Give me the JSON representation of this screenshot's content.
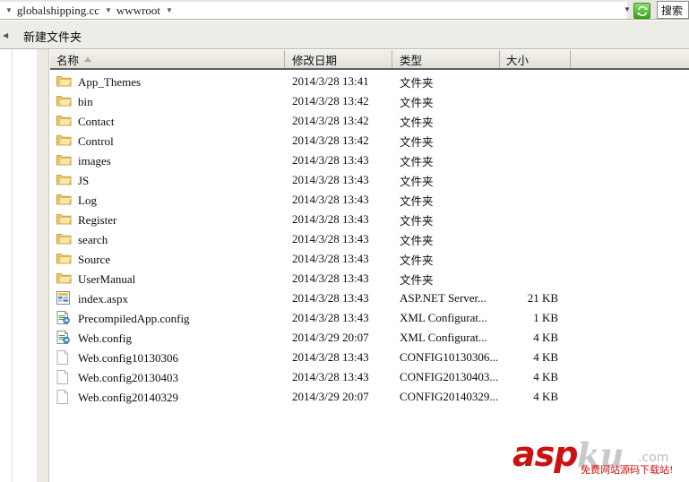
{
  "address_bar": {
    "breadcrumb": [
      "globalshipping.cc",
      "wwwroot"
    ],
    "dropdown_icon": "chevron-down-icon",
    "refresh_icon": "refresh-icon",
    "search_placeholder": "搜索"
  },
  "toolbar": {
    "overflow_icon": "chevron-left-icon",
    "new_folder_label": "新建文件夹"
  },
  "columns": [
    {
      "label": "名称",
      "sorted": "asc"
    },
    {
      "label": "修改日期",
      "sorted": ""
    },
    {
      "label": "类型",
      "sorted": ""
    },
    {
      "label": "大小",
      "sorted": ""
    },
    {
      "label": "",
      "sorted": ""
    }
  ],
  "files": [
    {
      "name": "App_Themes",
      "date": "2014/3/28 13:41",
      "type": "文件夹",
      "size": "",
      "icon": "folder-icon"
    },
    {
      "name": "bin",
      "date": "2014/3/28 13:42",
      "type": "文件夹",
      "size": "",
      "icon": "folder-icon"
    },
    {
      "name": "Contact",
      "date": "2014/3/28 13:42",
      "type": "文件夹",
      "size": "",
      "icon": "folder-icon"
    },
    {
      "name": "Control",
      "date": "2014/3/28 13:42",
      "type": "文件夹",
      "size": "",
      "icon": "folder-icon"
    },
    {
      "name": "images",
      "date": "2014/3/28 13:43",
      "type": "文件夹",
      "size": "",
      "icon": "folder-icon"
    },
    {
      "name": "JS",
      "date": "2014/3/28 13:43",
      "type": "文件夹",
      "size": "",
      "icon": "folder-icon"
    },
    {
      "name": "Log",
      "date": "2014/3/28 13:43",
      "type": "文件夹",
      "size": "",
      "icon": "folder-icon"
    },
    {
      "name": "Register",
      "date": "2014/3/28 13:43",
      "type": "文件夹",
      "size": "",
      "icon": "folder-icon"
    },
    {
      "name": "search",
      "date": "2014/3/28 13:43",
      "type": "文件夹",
      "size": "",
      "icon": "folder-icon"
    },
    {
      "name": "Source",
      "date": "2014/3/28 13:43",
      "type": "文件夹",
      "size": "",
      "icon": "folder-icon"
    },
    {
      "name": "UserManual",
      "date": "2014/3/28 13:43",
      "type": "文件夹",
      "size": "",
      "icon": "folder-icon"
    },
    {
      "name": "index.aspx",
      "date": "2014/3/28 13:43",
      "type": "ASP.NET Server...",
      "size": "21 KB",
      "icon": "aspx-file-icon"
    },
    {
      "name": "PrecompiledApp.config",
      "date": "2014/3/28 13:43",
      "type": "XML Configurat...",
      "size": "1 KB",
      "icon": "xml-config-file-icon"
    },
    {
      "name": "Web.config",
      "date": "2014/3/29 20:07",
      "type": "XML Configurat...",
      "size": "4 KB",
      "icon": "xml-config-file-icon"
    },
    {
      "name": "Web.config10130306",
      "date": "2014/3/28 13:43",
      "type": "CONFIG10130306...",
      "size": "4 KB",
      "icon": "blank-file-icon"
    },
    {
      "name": "Web.config20130403",
      "date": "2014/3/28 13:43",
      "type": "CONFIG20130403...",
      "size": "4 KB",
      "icon": "blank-file-icon"
    },
    {
      "name": "Web.config20140329",
      "date": "2014/3/29 20:07",
      "type": "CONFIG20140329...",
      "size": "4 KB",
      "icon": "blank-file-icon"
    }
  ],
  "watermark": {
    "brand_primary": "asp",
    "brand_secondary": "ku",
    "brand_tld": ".com",
    "tagline": "免费网站源码下载站!",
    "color_primary": "#cc1111",
    "color_secondary": "#c9c9c9"
  }
}
